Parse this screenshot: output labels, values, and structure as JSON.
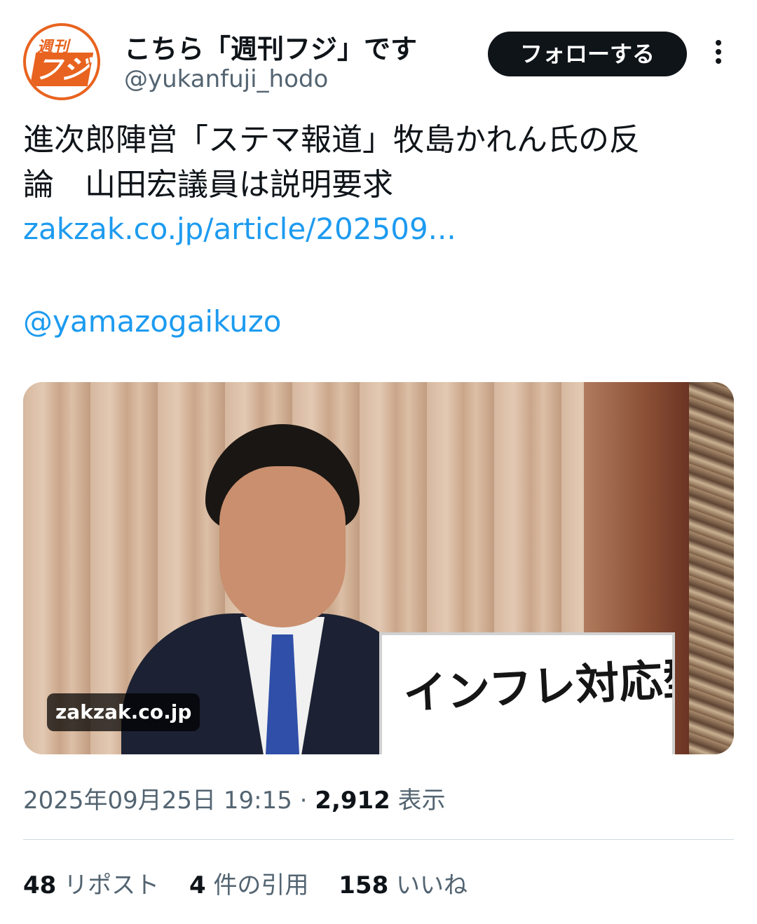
{
  "account": {
    "avatar_top_text": "週刊",
    "avatar_main_text": "フジ",
    "display_name": "こちら「週刊フジ」です",
    "handle": "@yukanfuji_hodo"
  },
  "header": {
    "follow_label": "フォローする",
    "more_icon": "more-vertical-icon"
  },
  "tweet": {
    "text_line1": "進次郎陣営「ステマ報道」牧島かれん氏の反",
    "text_line2": "論　山田宏議員は説明要求",
    "link": "zakzak.co.jp/article/202509...",
    "mention": "@yamazogaikuzo"
  },
  "media": {
    "source_badge": "zakzak.co.jp",
    "placard_text": "インフレ対応型"
  },
  "meta": {
    "timestamp": "2025年09月25日 19:15",
    "separator": "·",
    "views_count": "2,912",
    "views_label": "表示"
  },
  "stats": {
    "reposts_count": "48",
    "reposts_label": "リポスト",
    "quotes_count": "4",
    "quotes_label": "件の引用",
    "likes_count": "158",
    "likes_label": "いいね"
  },
  "colors": {
    "text_primary": "#0f1419",
    "text_secondary": "#536471",
    "link": "#1d9bf0",
    "brand_orange": "#e8631f"
  }
}
